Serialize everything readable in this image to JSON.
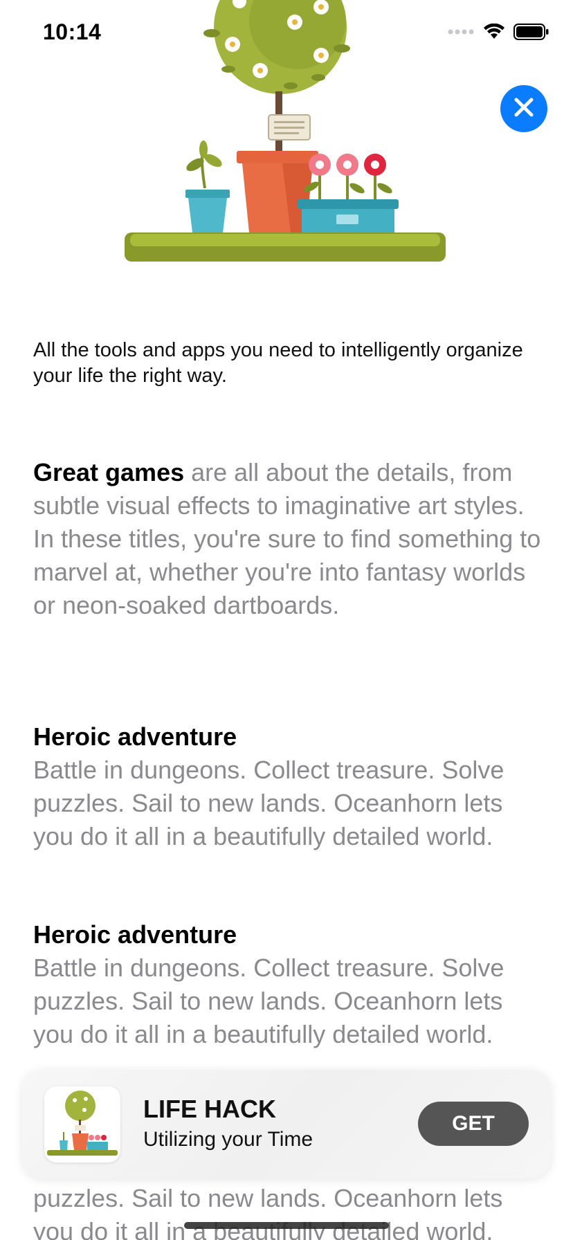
{
  "status_bar": {
    "time": "10:14",
    "icons": [
      "cellular-dots-icon",
      "wifi-icon",
      "battery-icon"
    ]
  },
  "hero": {
    "image": "plant-shelf-illustration"
  },
  "close_button": {
    "icon": "close-icon",
    "color": "#0a7cff"
  },
  "intro": "All the tools and apps you need to intelligently organize your life the right way.",
  "sections": [
    {
      "lead": "Great games",
      "body": " are all about the details, from subtle visual effects to imaginative art styles. In these titles, you're sure to find something to marvel at, whether you're into fantasy worlds or neon-soaked dartboards."
    },
    {
      "heading": "Heroic adventure",
      "body": "Battle in dungeons. Collect treasure. Solve puzzles. Sail to new lands. Oceanhorn lets you do it all in a beautifully detailed world."
    },
    {
      "heading": "Heroic adventure",
      "body": "Battle in dungeons. Collect treasure. Solve puzzles. Sail to new lands. Oceanhorn lets you do it all in a beautifully detailed world."
    },
    {
      "body": "puzzles. Sail to new lands. Oceanhorn lets you do it all in a beautifully detailed world."
    }
  ],
  "banner": {
    "title": "LIFE HACK",
    "subtitle": "Utilizing your Time",
    "button_label": "GET"
  }
}
